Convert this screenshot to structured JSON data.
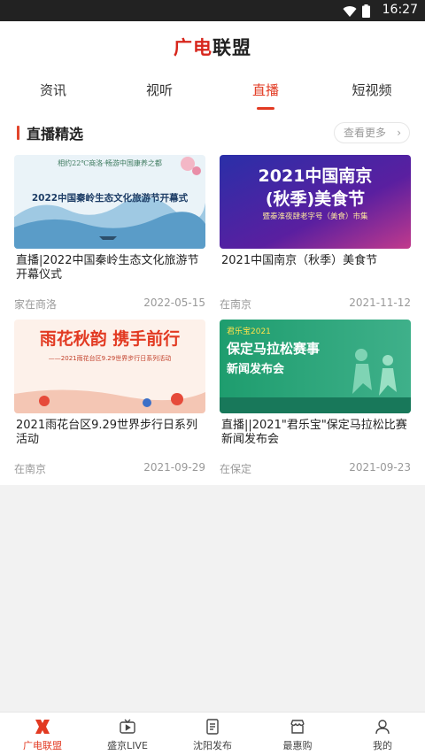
{
  "status": {
    "time": "16:27"
  },
  "app": {
    "logo_red": "广电",
    "logo_dark": "联盟"
  },
  "tabs": [
    {
      "label": "资讯"
    },
    {
      "label": "视听"
    },
    {
      "label": "直播"
    },
    {
      "label": "短视频"
    }
  ],
  "active_tab": "直播",
  "section": {
    "title": "直播精选",
    "more": "查看更多"
  },
  "cards": [
    {
      "title": "直播|2022中国秦岭生态文化旅游节开幕仪式",
      "location": "家在商洛",
      "date": "2022-05-15",
      "thumb_top": "相约22℃商洛·畅游中国康养之都",
      "thumb_main": "2022中国秦岭生态文化旅游节开幕式"
    },
    {
      "title": "2021中国南京（秋季）美食节",
      "location": "在南京",
      "date": "2021-11-12",
      "thumb_top": "2021中国南京",
      "thumb_main": "(秋季)美食节",
      "thumb_sub": "暨秦淮夜肆老字号（美食）市集"
    },
    {
      "title": "2021雨花台区9.29世界步行日系列活动",
      "location": "在南京",
      "date": "2021-09-29",
      "thumb_top": "雨花秋韵  携手前行",
      "thumb_sub": "——2021雨花台区9.29世界步行日系列活动"
    },
    {
      "title": "直播||2021\"君乐宝\"保定马拉松比赛新闻发布会",
      "location": "在保定",
      "date": "2021-09-23",
      "thumb_top": "君乐宝2021",
      "thumb_main": "保定马拉松赛事",
      "thumb_sub": "新闻发布会"
    }
  ],
  "bottom_tabs": [
    {
      "label": "广电联盟",
      "icon": "alliance-logo-icon"
    },
    {
      "label": "盛京LIVE",
      "icon": "tv-icon"
    },
    {
      "label": "沈阳发布",
      "icon": "document-icon"
    },
    {
      "label": "最惠购",
      "icon": "shop-icon"
    },
    {
      "label": "我的",
      "icon": "user-icon"
    }
  ],
  "colors": {
    "accent": "#e23a22",
    "logo_red": "#d7261c"
  }
}
